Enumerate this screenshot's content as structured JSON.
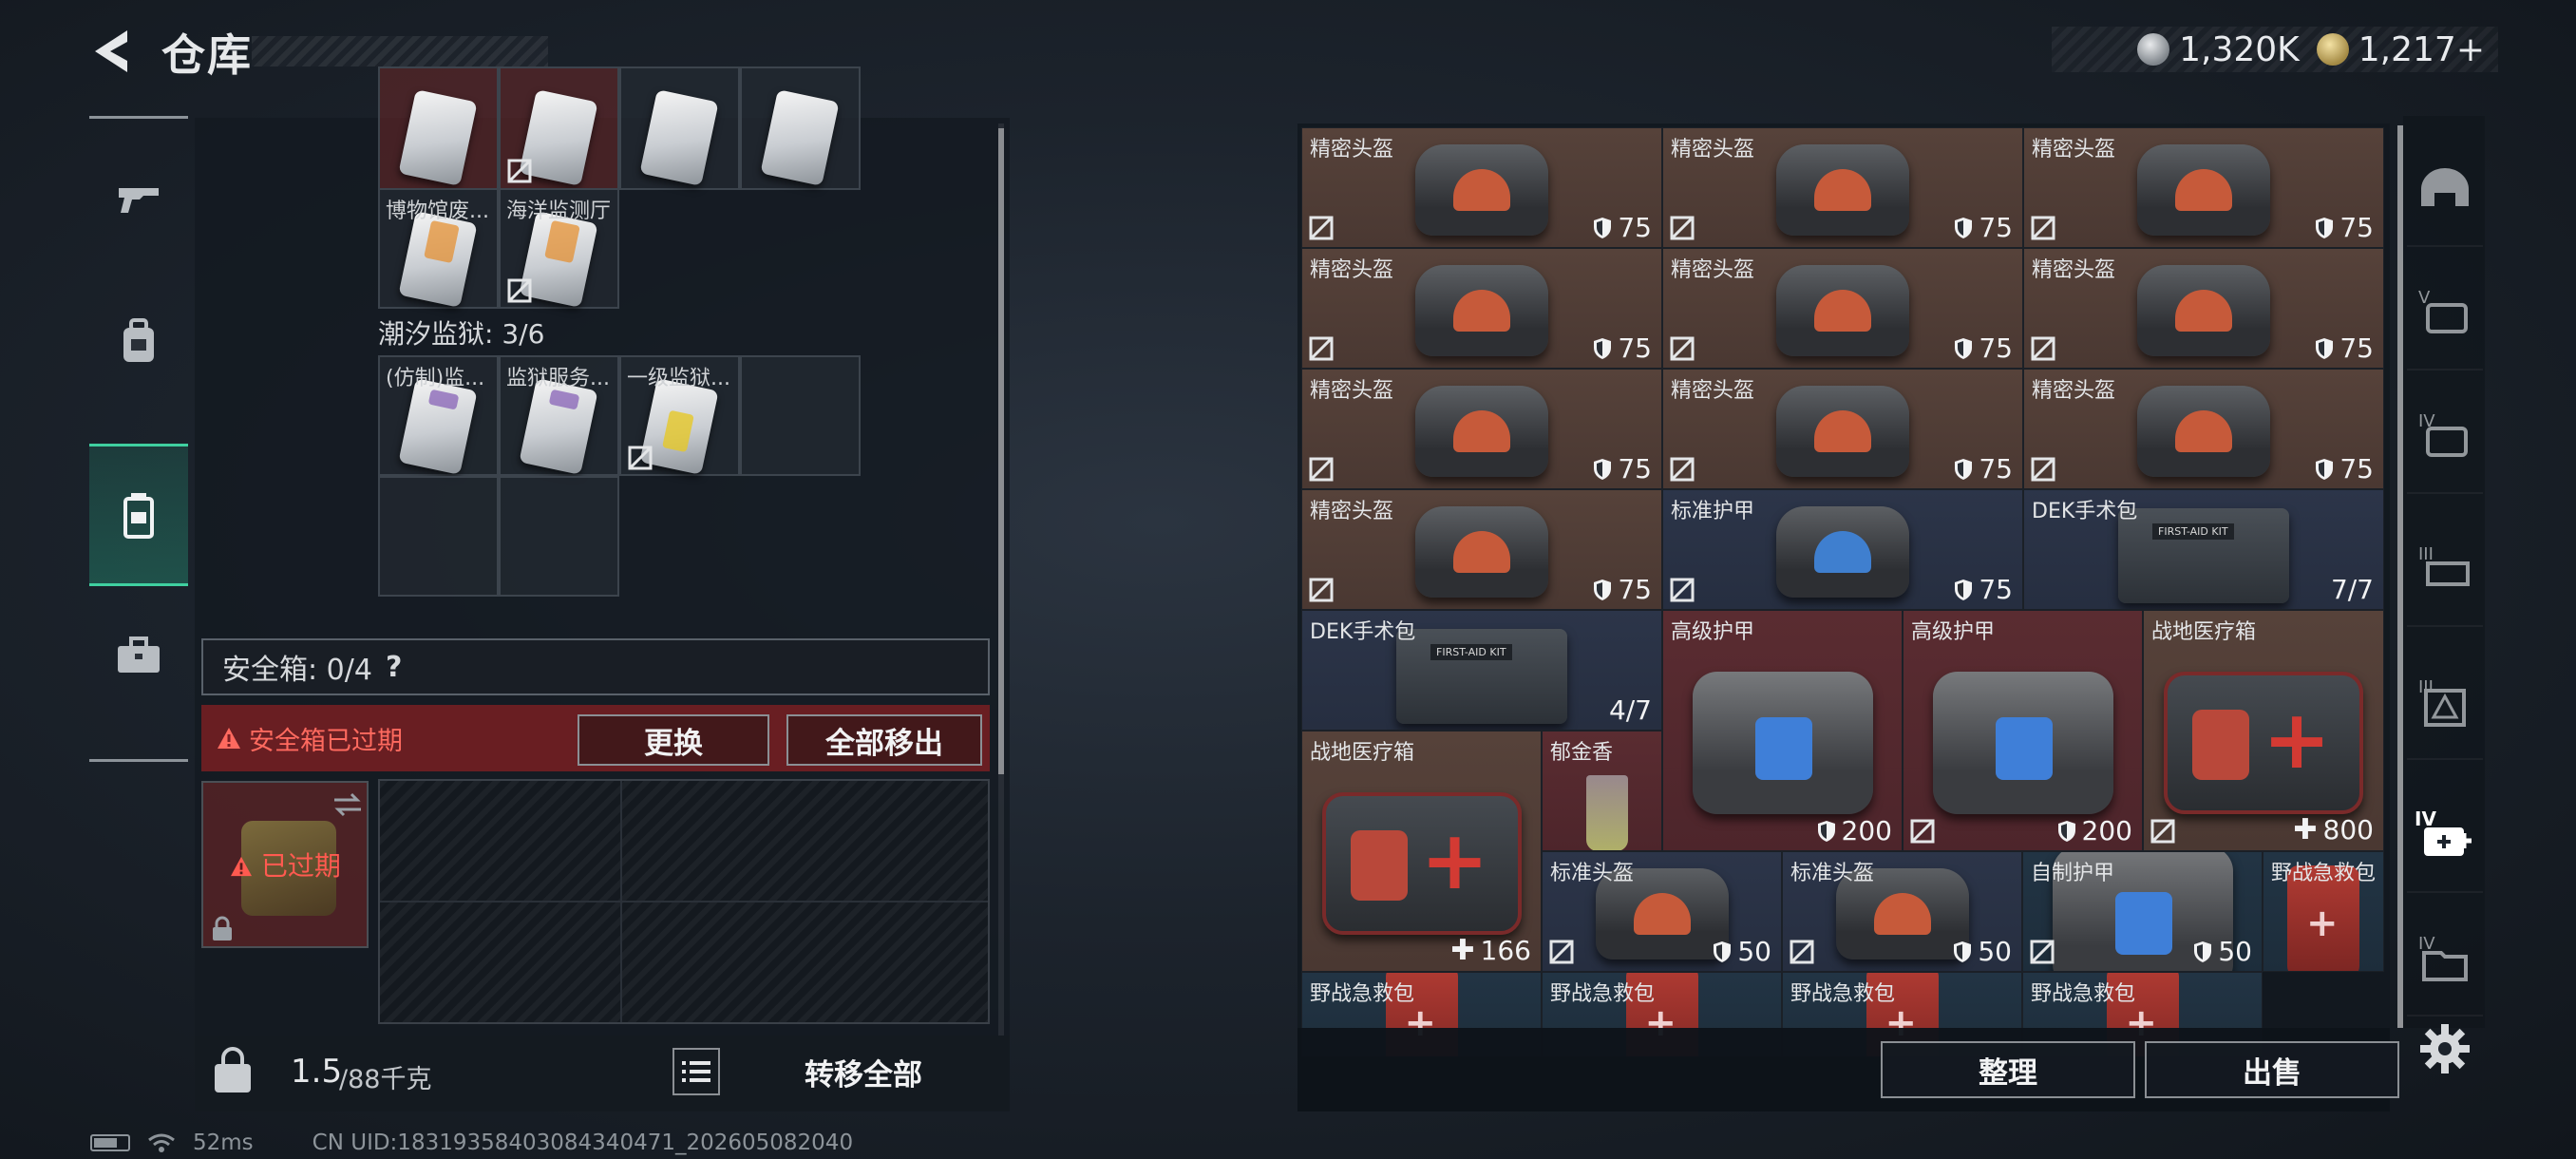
{
  "header": {
    "title": "仓库",
    "currency": [
      {
        "icon": "silver-coin-icon",
        "value": "1,320K"
      },
      {
        "icon": "gold-coin-icon",
        "value": "1,217+"
      }
    ]
  },
  "left_tabs": [
    {
      "icon": "gun-icon"
    },
    {
      "icon": "backpack-icon"
    },
    {
      "icon": "container-icon",
      "active": true
    },
    {
      "icon": "briefcase-icon"
    }
  ],
  "containers": {
    "top_row": [
      {
        "label": "",
        "locked": false
      },
      {
        "label": "",
        "locked": true
      },
      {
        "label": "",
        "locked": false
      },
      {
        "label": "",
        "locked": false
      }
    ],
    "row2": [
      {
        "label": "博物馆废...",
        "locked": false
      },
      {
        "label": "海洋监测厅",
        "locked": true
      }
    ],
    "group_label": "潮汐监狱: 3/6",
    "group_items": [
      {
        "label": "(仿制)监...",
        "locked": false
      },
      {
        "label": "监狱服务...",
        "locked": false
      },
      {
        "label": "一级监狱...",
        "locked": true
      }
    ]
  },
  "safe_box": {
    "label": "安全箱: 0/4",
    "help": "?",
    "warning": "安全箱已过期",
    "replace_label": "更换",
    "move_all_label": "全部移出",
    "expired_label": "已过期"
  },
  "weight": {
    "current": "1.5",
    "capacity": "/88千克"
  },
  "transfer_all_label": "转移全部",
  "status": {
    "ping": "52ms",
    "uid": "CN UID:18319358403084340471_202605082040"
  },
  "items": [
    {
      "name": "精密头盔",
      "value": "75",
      "kind": "helmet",
      "bg": "brown",
      "stat": "shield"
    },
    {
      "name": "精密头盔",
      "value": "75",
      "kind": "helmet",
      "bg": "brown",
      "stat": "shield"
    },
    {
      "name": "精密头盔",
      "value": "75",
      "kind": "helmet",
      "bg": "brown",
      "stat": "shield"
    },
    {
      "name": "精密头盔",
      "value": "75",
      "kind": "helmet",
      "bg": "brown",
      "stat": "shield"
    },
    {
      "name": "精密头盔",
      "value": "75",
      "kind": "helmet",
      "bg": "brown",
      "stat": "shield"
    },
    {
      "name": "精密头盔",
      "value": "75",
      "kind": "helmet",
      "bg": "brown",
      "stat": "shield"
    },
    {
      "name": "精密头盔",
      "value": "75",
      "kind": "helmet",
      "bg": "brown",
      "stat": "shield"
    },
    {
      "name": "精密头盔",
      "value": "75",
      "kind": "helmet",
      "bg": "brown",
      "stat": "shield"
    },
    {
      "name": "精密头盔",
      "value": "75",
      "kind": "helmet",
      "bg": "brown",
      "stat": "shield"
    },
    {
      "name": "精密头盔",
      "value": "75",
      "kind": "helmet",
      "bg": "brown",
      "stat": "shield"
    },
    {
      "name": "标准护甲",
      "value": "75",
      "kind": "helmet-blue",
      "bg": "navy",
      "stat": "shield"
    },
    {
      "name": "DEK手术包",
      "value": "7/7",
      "kind": "kit",
      "bg": "navy",
      "stat": "none"
    },
    {
      "name": "DEK手术包",
      "value": "4/7",
      "kind": "kit",
      "bg": "navy",
      "stat": "none"
    },
    {
      "name": "高级护甲",
      "value": "200",
      "kind": "vest",
      "bg": "maroon",
      "stat": "shield"
    },
    {
      "name": "高级护甲",
      "value": "200",
      "kind": "vest",
      "bg": "maroon",
      "stat": "shield"
    },
    {
      "name": "战地医疗箱",
      "value": "800",
      "kind": "medbox",
      "bg": "brown",
      "stat": "plus"
    },
    {
      "name": "战地医疗箱",
      "value": "166",
      "kind": "medbox",
      "bg": "brown",
      "stat": "plus"
    },
    {
      "name": "郁金香",
      "value": "",
      "kind": "cup",
      "bg": "maroon",
      "stat": "none"
    },
    {
      "name": "标准头盔",
      "value": "50",
      "kind": "helmet",
      "bg": "navy",
      "stat": "shield"
    },
    {
      "name": "标准头盔",
      "value": "50",
      "kind": "helmet",
      "bg": "navy",
      "stat": "shield"
    },
    {
      "name": "自制护甲",
      "value": "50",
      "kind": "vest",
      "bg": "teal",
      "stat": "shield"
    },
    {
      "name": "野战急救包",
      "value": "",
      "kind": "redbag",
      "bg": "teal",
      "stat": "none"
    },
    {
      "name": "野战急救包",
      "value": "",
      "kind": "redbag",
      "bg": "teal",
      "stat": "none"
    },
    {
      "name": "野战急救包",
      "value": "",
      "kind": "redbag",
      "bg": "teal",
      "stat": "none"
    },
    {
      "name": "野战急救包",
      "value": "",
      "kind": "redbag",
      "bg": "teal",
      "stat": "none"
    },
    {
      "name": "野战急救包",
      "value": "",
      "kind": "redbag",
      "bg": "teal",
      "stat": "none"
    }
  ],
  "right_actions": {
    "sort_label": "整理",
    "sell_label": "出售"
  },
  "right_tabs": [
    {
      "icon": "helmet-filter-icon"
    },
    {
      "icon": "vest-v-filter-icon",
      "tier": "V"
    },
    {
      "icon": "vest-iv-filter-icon",
      "tier": "IV"
    },
    {
      "icon": "vest-iii-filter-icon",
      "tier": "III"
    },
    {
      "icon": "warning-filter-icon",
      "tier": "III"
    },
    {
      "icon": "medkit-iv-filter-icon",
      "tier": "IV",
      "active": true
    },
    {
      "icon": "folder-iv-filter-icon",
      "tier": "IV"
    }
  ]
}
